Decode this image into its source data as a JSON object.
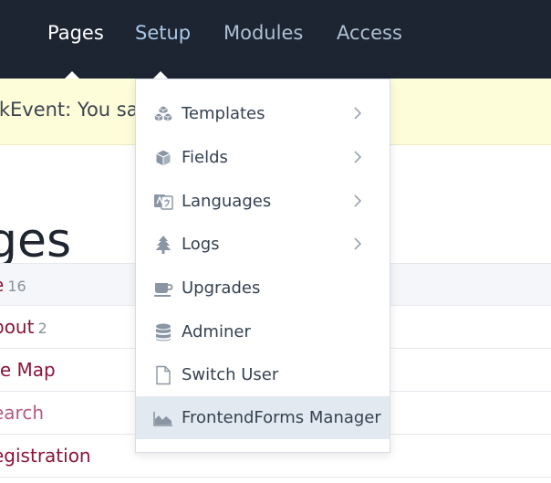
{
  "nav": {
    "items": [
      {
        "label": "Pages",
        "state": "active"
      },
      {
        "label": "Setup",
        "state": "open"
      },
      {
        "label": "Modules",
        "state": "normal"
      },
      {
        "label": "Access",
        "state": "normal"
      }
    ]
  },
  "notice": {
    "text": "okEvent: You sav"
  },
  "page": {
    "title": "ges"
  },
  "tree": {
    "rows": [
      {
        "title": "e",
        "count": "16"
      },
      {
        "title": "bout",
        "count": "2"
      },
      {
        "title": "te Map",
        "count": ""
      },
      {
        "title": "earch",
        "count": ""
      },
      {
        "title": "egistration",
        "count": ""
      }
    ]
  },
  "setup_menu": {
    "items": [
      {
        "label": "Templates",
        "icon": "cubes-icon",
        "has_submenu": true
      },
      {
        "label": "Fields",
        "icon": "cube-icon",
        "has_submenu": true
      },
      {
        "label": "Languages",
        "icon": "language-icon",
        "has_submenu": true
      },
      {
        "label": "Logs",
        "icon": "tree-icon",
        "has_submenu": true
      },
      {
        "label": "Upgrades",
        "icon": "coffee-icon",
        "has_submenu": false
      },
      {
        "label": "Adminer",
        "icon": "database-icon",
        "has_submenu": false
      },
      {
        "label": "Switch User",
        "icon": "file-icon",
        "has_submenu": false
      },
      {
        "label": "FrontendForms Manager",
        "icon": "area-chart-icon",
        "has_submenu": false,
        "highlighted": true
      }
    ]
  },
  "colors": {
    "topbar": "#1d2532",
    "notice_bg": "#fefdd9",
    "link": "#8b1437",
    "menu_highlight": "#e2e9f0",
    "icon": "#8a96a4"
  }
}
